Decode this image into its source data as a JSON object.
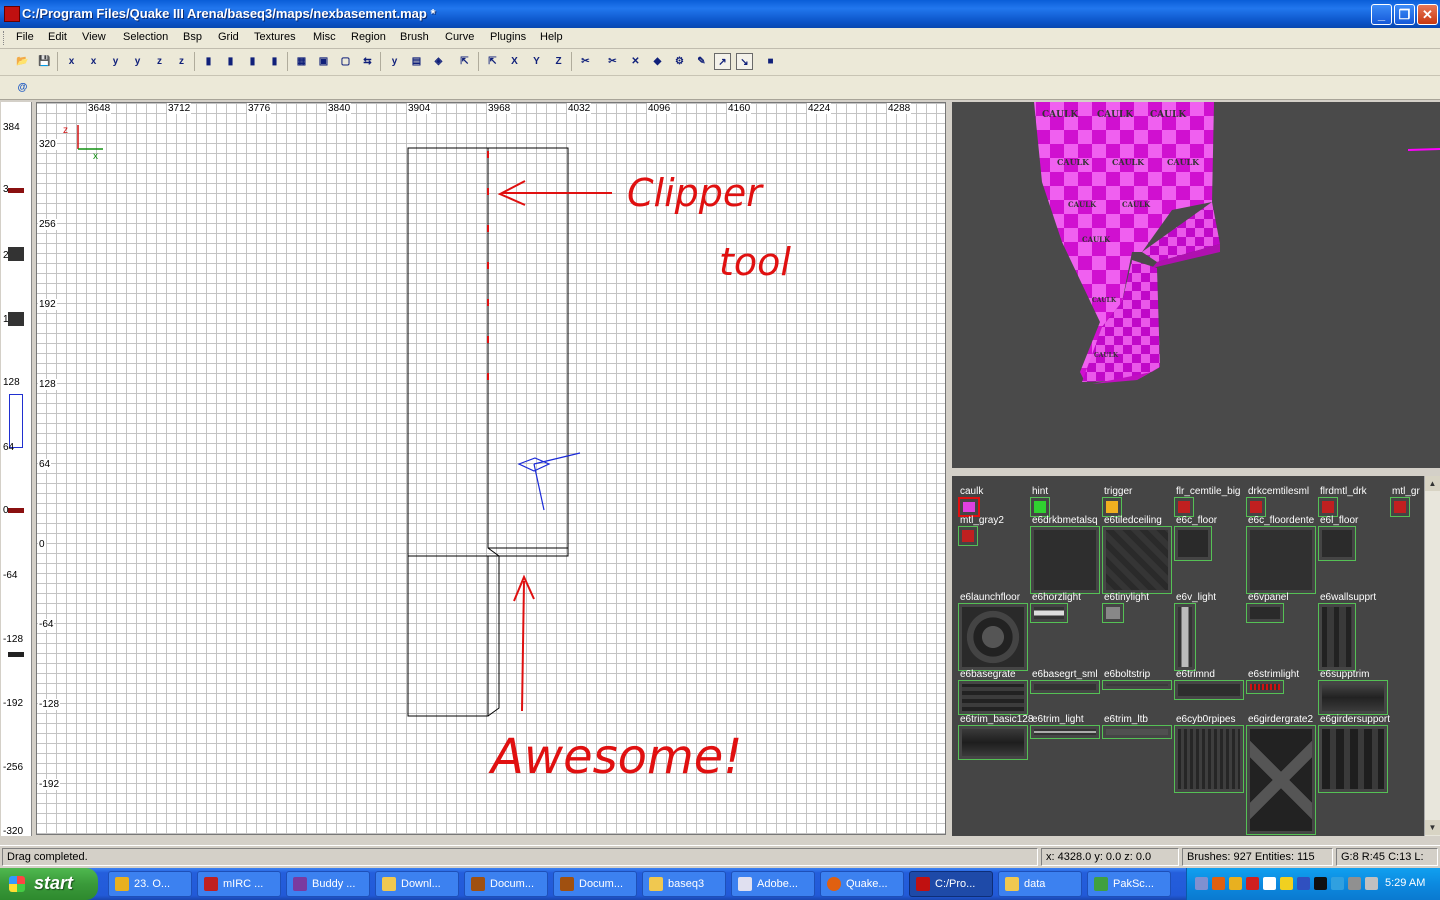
{
  "window": {
    "title": "C:/Program Files/Quake III Arena/baseq3/maps/nexbasement.map *",
    "minimize_glyph": "_",
    "maximize_glyph": "❐",
    "close_glyph": "✕"
  },
  "menu": [
    "File",
    "Edit",
    "View",
    "Selection",
    "Bsp",
    "Grid",
    "Textures",
    "Misc",
    "Region",
    "Brush",
    "Curve",
    "Plugins",
    "Help"
  ],
  "toolbar_glyphs": [
    "📂",
    "💾",
    "x",
    "x",
    "y",
    "y",
    "z",
    "z",
    "▮",
    "▮",
    "▮",
    "▮",
    "▦",
    "▣",
    "▢",
    "⇆",
    "y",
    "▤",
    "◈",
    "⇱",
    "X",
    "Y",
    "Z",
    "✂",
    "✂",
    "✕",
    "◆",
    "⚙",
    "✎",
    "↗",
    "↘",
    "■"
  ],
  "grid_view": {
    "x_labels": [
      "3648",
      "3712",
      "3776",
      "3840",
      "3904",
      "3968",
      "4032",
      "4096",
      "4160",
      "4224",
      "4288"
    ],
    "y_labels": [
      "320",
      "256",
      "192",
      "128",
      "64",
      "0",
      "-64",
      "-128",
      "-192"
    ],
    "axis_z": "z",
    "axis_x": "x",
    "annotation_clipper": "Clipper",
    "annotation_tool": "tool",
    "annotation_awesome": "Awesome!"
  },
  "z_ruler": {
    "labels": [
      "384",
      "3",
      "2",
      "1",
      "128",
      "64",
      "0",
      "-64",
      "-128",
      "-192",
      "-256",
      "-320"
    ]
  },
  "camera": {
    "texture_label": "CAULK",
    "accent_color": "#ff00ff"
  },
  "texture_browser": {
    "textures": [
      {
        "name": "caulk",
        "selected": true
      },
      {
        "name": "hint"
      },
      {
        "name": "trigger"
      },
      {
        "name": "flr_cemtile_big"
      },
      {
        "name": "drkcemtilesml"
      },
      {
        "name": "flrdmtl_drk"
      },
      {
        "name": "mtl_gr"
      },
      {
        "name": "mtl_gray2"
      },
      {
        "name": "e6drkbmetalsq"
      },
      {
        "name": "e6tiledceiling"
      },
      {
        "name": "e6c_floor"
      },
      {
        "name": "e6c_floordente"
      },
      {
        "name": "e6l_floor"
      },
      {
        "name": "e6launchfloor"
      },
      {
        "name": "e6horzlight"
      },
      {
        "name": "e6tinylight"
      },
      {
        "name": "e6v_light"
      },
      {
        "name": "e6vpanel"
      },
      {
        "name": "e6wallsupprt"
      },
      {
        "name": "e6basegrate"
      },
      {
        "name": "e6basegrt_sml"
      },
      {
        "name": "e6boltstrip"
      },
      {
        "name": "e6trimnd"
      },
      {
        "name": "e6strimlight"
      },
      {
        "name": "e6supptrim"
      },
      {
        "name": "e6trim_basic128"
      },
      {
        "name": "e6trim_light"
      },
      {
        "name": "e6trim_ltb"
      },
      {
        "name": "e6cyb0rpipes"
      },
      {
        "name": "e6girdergrate2"
      },
      {
        "name": "e6girdersupport"
      }
    ],
    "scroll_up": "▲",
    "scroll_down": "▼"
  },
  "status": {
    "message": "Drag completed.",
    "coords": "x: 4328.0  y: 0.0  z: 0.0",
    "counts": "Brushes: 927 Entities: 115",
    "grid": "G:8 R:45 C:13 L:"
  },
  "taskbar": {
    "start_label": "start",
    "tasks": [
      {
        "label": "23. O...",
        "icon_color": "#e8b020"
      },
      {
        "label": "mIRC ...",
        "icon_color": "#c02020"
      },
      {
        "label": "Buddy ...",
        "icon_color": "#7a3aa0"
      },
      {
        "label": "Downl...",
        "icon_color": "#f0c850"
      },
      {
        "label": "Docum...",
        "icon_color": "#a05010"
      },
      {
        "label": "Docum...",
        "icon_color": "#a05010"
      },
      {
        "label": "baseq3",
        "icon_color": "#f0c850"
      },
      {
        "label": "Adobe...",
        "icon_color": "#e0e0f0"
      },
      {
        "label": "Quake...",
        "icon_color": "#e06010"
      },
      {
        "label": "C:/Pro...",
        "icon_color": "#c01010",
        "active": true
      },
      {
        "label": "data",
        "icon_color": "#f0c850"
      },
      {
        "label": "PakSc...",
        "icon_color": "#40a040"
      }
    ],
    "clock": "5:29 AM"
  }
}
